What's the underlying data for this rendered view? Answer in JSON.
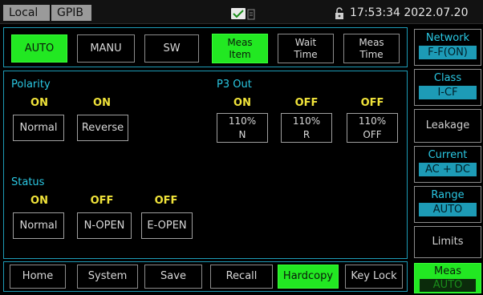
{
  "status_bar": {
    "local": "Local",
    "gpib": "GPIB",
    "datetime": "17:53:34 2022.07.20"
  },
  "top_tabs": [
    {
      "label": "AUTO",
      "active": true
    },
    {
      "label": "MANU",
      "active": false
    },
    {
      "label": "SW",
      "active": false
    }
  ],
  "meas_tabs": [
    {
      "line1": "Meas",
      "line2": "Item",
      "active": true
    },
    {
      "line1": "Wait",
      "line2": "Time",
      "active": false
    },
    {
      "line1": "Meas",
      "line2": "Time",
      "active": false
    }
  ],
  "polarity": {
    "title": "Polarity",
    "items": [
      {
        "state": "ON",
        "label": "Normal"
      },
      {
        "state": "ON",
        "label": "Reverse"
      }
    ]
  },
  "p3_out": {
    "title": "P3 Out",
    "items": [
      {
        "state": "ON",
        "line1": "110%",
        "line2": "N"
      },
      {
        "state": "OFF",
        "line1": "110%",
        "line2": "R"
      },
      {
        "state": "OFF",
        "line1": "110%",
        "line2": "OFF"
      }
    ]
  },
  "status": {
    "title": "Status",
    "items": [
      {
        "state": "ON",
        "label": "Normal"
      },
      {
        "state": "OFF",
        "label": "N-OPEN"
      },
      {
        "state": "OFF",
        "label": "E-OPEN"
      }
    ]
  },
  "side_panel": {
    "network": {
      "title": "Network",
      "value": "F-F(ON)"
    },
    "class": {
      "title": "Class",
      "value": "I-CF"
    },
    "leakage": "Leakage",
    "current": {
      "title": "Current",
      "value": "AC + DC"
    },
    "range": {
      "title": "Range",
      "value": "AUTO"
    },
    "limits": "Limits",
    "meas": {
      "title": "Meas",
      "value": "AUTO"
    }
  },
  "bottom_bar": [
    {
      "label": "Home",
      "active": false
    },
    {
      "label": "System",
      "active": false
    },
    {
      "label": "Save",
      "active": false
    },
    {
      "label": "Recall",
      "active": false
    },
    {
      "label": "Hardcopy",
      "active": true
    },
    {
      "label": "Key Lock",
      "active": false
    }
  ],
  "colors": {
    "accent_green": "#22e822",
    "accent_cyan": "#1d9bb6",
    "label_yellow": "#f0e33a",
    "title_cyan": "#2ac7e2"
  },
  "icons": [
    "check-icon",
    "battery-icon",
    "lock-icon"
  ]
}
